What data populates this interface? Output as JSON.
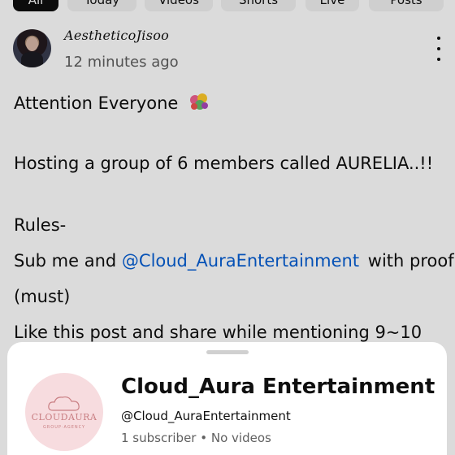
{
  "chips": [
    {
      "label": "All",
      "active": true
    },
    {
      "label": "Today",
      "active": false
    },
    {
      "label": "Videos",
      "active": false
    },
    {
      "label": "Shorts",
      "active": false
    },
    {
      "label": "Live",
      "active": false
    },
    {
      "label": "Posts",
      "active": false
    }
  ],
  "post": {
    "author": "AestheticoJisoo",
    "timestamp": "12 minutes ago",
    "menu_icon": "more-vertical-icon",
    "lines": {
      "l1": "Attention Everyone",
      "l2": "Hosting a group of 6 members called AURELIA..!!",
      "l3": "Rules-",
      "l4_prefix": "Sub me and",
      "l4_mention": "@Cloud_AuraEntertainment",
      "l4_suffix": "with proof",
      "l5": "(must)",
      "l6": "Like this post and share while mentioning 9~10"
    }
  },
  "channel_sheet": {
    "logo_text": "CLOUDAURA",
    "logo_subtext": "GROUP·AGENCY",
    "name": "Cloud_Aura Entertainment",
    "handle": "@Cloud_AuraEntertainment",
    "stats": "1 subscriber • No videos"
  },
  "colors": {
    "mention": "#065fd4",
    "secondary_text": "#606060",
    "scrim": "rgba(0,0,0,0.14)",
    "channel_avatar_bg": "#f7dcdf"
  }
}
